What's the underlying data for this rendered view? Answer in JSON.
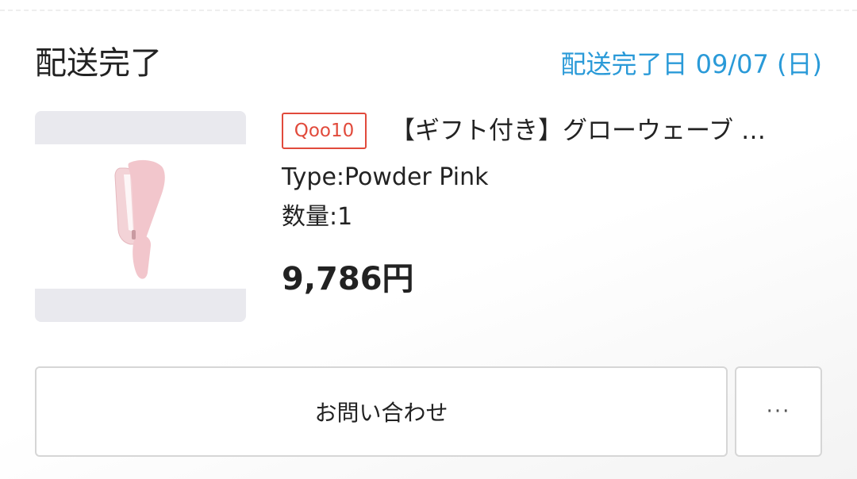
{
  "order": {
    "status": "配送完了",
    "delivered_date": "配送完了日 09/07 (日)"
  },
  "product": {
    "image_icon": "hair-iron-product-image",
    "shop_badge": "Qoo10",
    "name": "【ギフト付き】グローウェーブ …",
    "type": "Type:Powder Pink",
    "quantity": "数量:1",
    "price": "9,786円"
  },
  "actions": {
    "inquiry_label": "お問い合わせ",
    "more_label": "···"
  },
  "colors": {
    "accent_blue": "#2a9ad8",
    "badge_red": "#e14a3b",
    "product_pink": "#f2c6cc"
  }
}
